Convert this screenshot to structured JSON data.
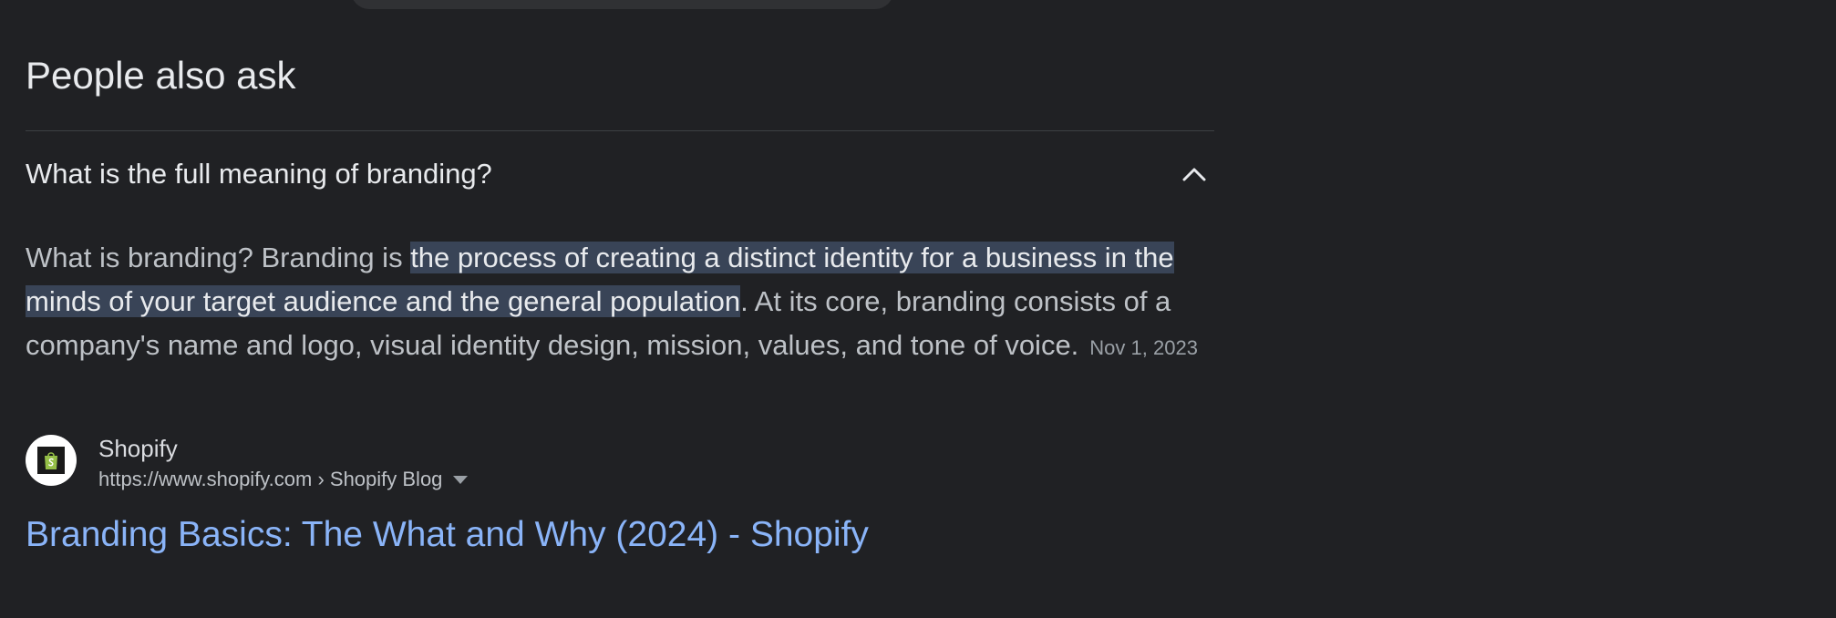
{
  "people_also_ask": {
    "title": "People also ask",
    "question": "What is the full meaning of branding?",
    "toggle_icon": "chevron-up-icon",
    "answer": {
      "before": "What is branding? Branding is ",
      "highlighted": "the process of creating a distinct identity for a business in the minds of your target audience and the general population",
      "after": ". At its core, branding consists of a company's name and logo, visual identity design, mission, values, and tone of voice.",
      "date": "Nov 1, 2023"
    },
    "source": {
      "icon": "shopify-bag-icon",
      "name": "Shopify",
      "url": "https://www.shopify.com › Shopify Blog"
    },
    "result_title": "Branding Basics: The What and Why (2024) - Shopify"
  },
  "colors": {
    "background": "#202124",
    "link": "#8ab4f8",
    "highlight": "#394457",
    "shopify_green": "#95bf47"
  }
}
